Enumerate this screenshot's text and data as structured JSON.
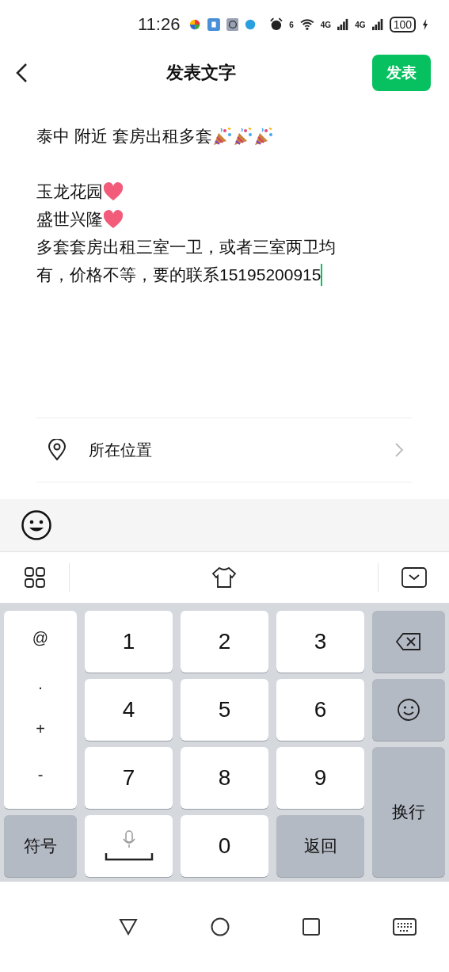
{
  "status_bar": {
    "time": "11:26",
    "wifi_label": "6",
    "signal_labels": [
      "4G",
      "4G"
    ],
    "battery": "100"
  },
  "header": {
    "title": "发表文字",
    "publish_button": "发表"
  },
  "post": {
    "lines": [
      {
        "kind": "text",
        "text": "泰中 附近 套房出租多套",
        "icons": [
          {
            "kind": "party"
          },
          {
            "kind": "party"
          },
          {
            "kind": "party"
          }
        ]
      },
      {
        "kind": "blank"
      },
      {
        "kind": "text",
        "text": "玉龙花园",
        "icons": [
          {
            "kind": "heart"
          }
        ]
      },
      {
        "kind": "text",
        "text": "盛世兴隆",
        "icons": [
          {
            "kind": "heart"
          }
        ]
      },
      {
        "kind": "text",
        "text": "多套套房出租三室一卫，或者三室两卫均"
      },
      {
        "kind": "text",
        "text": "有，价格不等，要的联系15195200915",
        "cursor": true
      }
    ]
  },
  "location": {
    "label": "所在位置"
  },
  "keyboard": {
    "side_symbols": [
      "@",
      ".",
      "+",
      "-"
    ],
    "digits": [
      "1",
      "2",
      "3",
      "4",
      "5",
      "6",
      "7",
      "8",
      "9"
    ],
    "zero": "0",
    "symbol_key": "符号",
    "return_key": "返回",
    "enter_key": "换行"
  }
}
